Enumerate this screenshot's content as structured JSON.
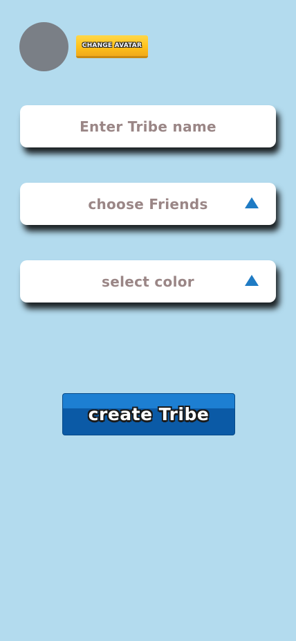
{
  "header": {
    "change_avatar_label": "Change Avatar"
  },
  "form": {
    "tribe_name_placeholder": "Enter Tribe name",
    "choose_friends_label": "choose Friends",
    "select_color_label": "select color",
    "dropdown_icon": "triangle-up-icon"
  },
  "actions": {
    "create_label": "create Tribe"
  },
  "colors": {
    "background": "#b3dbee",
    "avatar_placeholder": "#7a7f86",
    "accent_yellow": "#ffc21a",
    "accent_blue": "#1f7bc4",
    "field_text": "#9a8686"
  }
}
